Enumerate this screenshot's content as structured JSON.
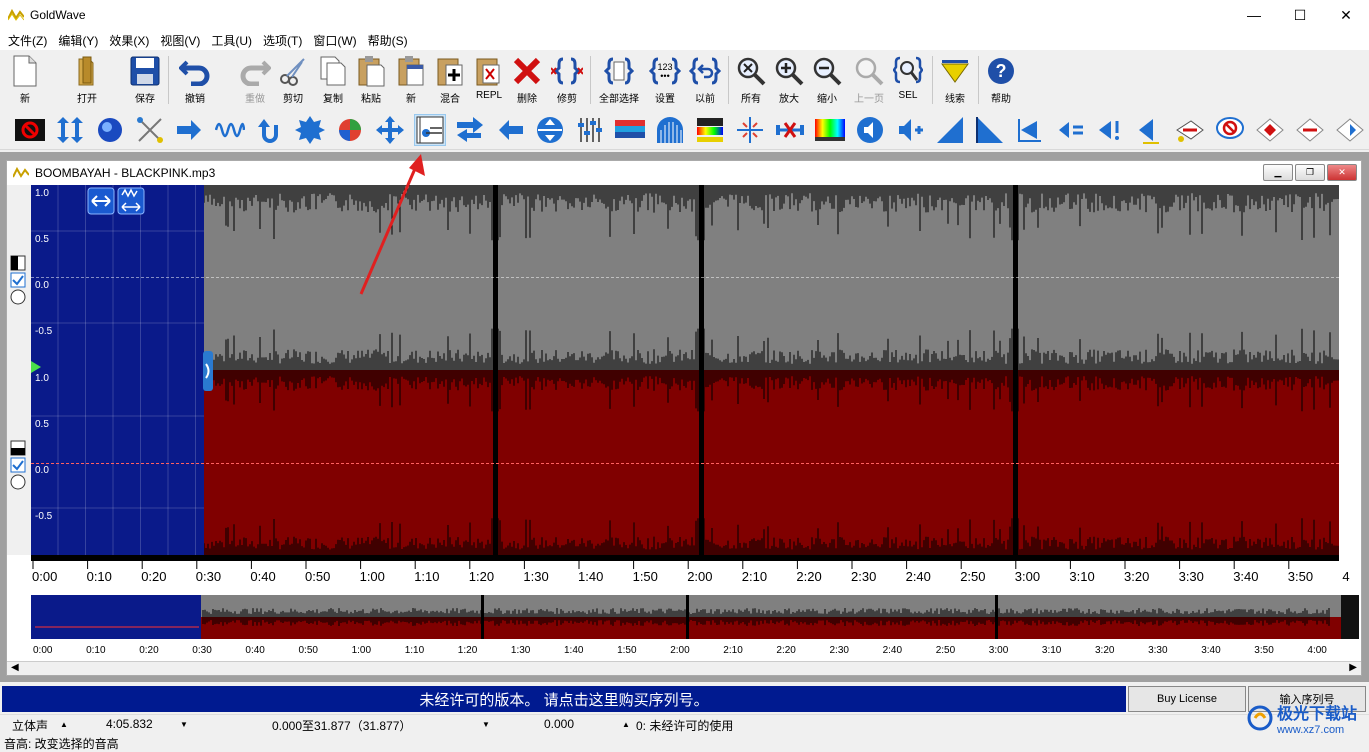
{
  "window": {
    "title": "GoldWave",
    "controls": [
      "—",
      "☐",
      "✕"
    ]
  },
  "menu": [
    "文件(Z)",
    "编辑(Y)",
    "效果(X)",
    "视图(V)",
    "工具(U)",
    "选项(T)",
    "窗口(W)",
    "帮助(S)"
  ],
  "toolbar1": [
    {
      "label": "新",
      "icon": "new-file-icon"
    },
    {
      "label": "打开",
      "icon": "open-folder-icon"
    },
    {
      "label": "保存",
      "icon": "save-icon"
    },
    {
      "label": "撤销",
      "icon": "undo-icon"
    },
    {
      "label": "重做",
      "icon": "redo-icon",
      "disabled": true
    },
    {
      "label": "剪切",
      "icon": "cut-icon"
    },
    {
      "label": "复制",
      "icon": "copy-icon"
    },
    {
      "label": "粘贴",
      "icon": "paste-icon"
    },
    {
      "label": "新",
      "icon": "paste-new-icon"
    },
    {
      "label": "混合",
      "icon": "mix-icon"
    },
    {
      "label": "REPL",
      "icon": "replace-icon"
    },
    {
      "label": "删除",
      "icon": "delete-icon"
    },
    {
      "label": "修剪",
      "icon": "trim-icon"
    },
    {
      "label": "全部选择",
      "icon": "select-all-icon"
    },
    {
      "label": "设置",
      "icon": "set-icon"
    },
    {
      "label": "以前",
      "icon": "previous-icon"
    },
    {
      "label": "所有",
      "icon": "zoom-all-icon"
    },
    {
      "label": "放大",
      "icon": "zoom-in-icon"
    },
    {
      "label": "缩小",
      "icon": "zoom-out-icon"
    },
    {
      "label": "上一页",
      "icon": "zoom-previous-icon",
      "disabled": true
    },
    {
      "label": "SEL",
      "icon": "zoom-selection-icon"
    },
    {
      "label": "线索",
      "icon": "cue-icon"
    },
    {
      "label": "帮助",
      "icon": "help-icon"
    }
  ],
  "document": {
    "title": "BOOMBAYAH - BLACKPINK.mp3",
    "ylabels": [
      "1.0",
      "0.5",
      "0.0",
      "-0.5"
    ],
    "timeline": [
      "0:00",
      "0:10",
      "0:20",
      "0:30",
      "0:40",
      "0:50",
      "1:00",
      "1:10",
      "1:20",
      "1:30",
      "1:40",
      "1:50",
      "2:00",
      "2:10",
      "2:20",
      "2:30",
      "2:40",
      "2:50",
      "3:00",
      "3:10",
      "3:20",
      "3:30",
      "3:40",
      "3:50",
      "4"
    ],
    "overview_timeline": [
      "0:00",
      "0:10",
      "0:20",
      "0:30",
      "0:40",
      "0:50",
      "1:00",
      "1:10",
      "1:20",
      "1:30",
      "1:40",
      "1:50",
      "2:00",
      "2:10",
      "2:20",
      "2:30",
      "2:40",
      "2:50",
      "3:00",
      "3:10",
      "3:20",
      "3:30",
      "3:40",
      "3:50",
      "4:00"
    ]
  },
  "license": {
    "message": "未经许可的版本。 请点击这里购买序列号。",
    "buy_label": "Buy License",
    "serial_label": "输入序列号"
  },
  "status": {
    "channels": "立体声",
    "length": "4:05.832",
    "selection": "0.000至31.877（31.877）",
    "position": "0.000",
    "license_state": "0:  未经许可的使用",
    "hint": "音高: 改变选择的音高"
  },
  "watermark": {
    "brand": "极光下载站",
    "url": "www.xz7.com"
  },
  "colors": {
    "selection_bg": "#0a1a8a",
    "top_channel": "#808080",
    "bottom_channel": "#800000",
    "license_bar": "#001a90"
  }
}
